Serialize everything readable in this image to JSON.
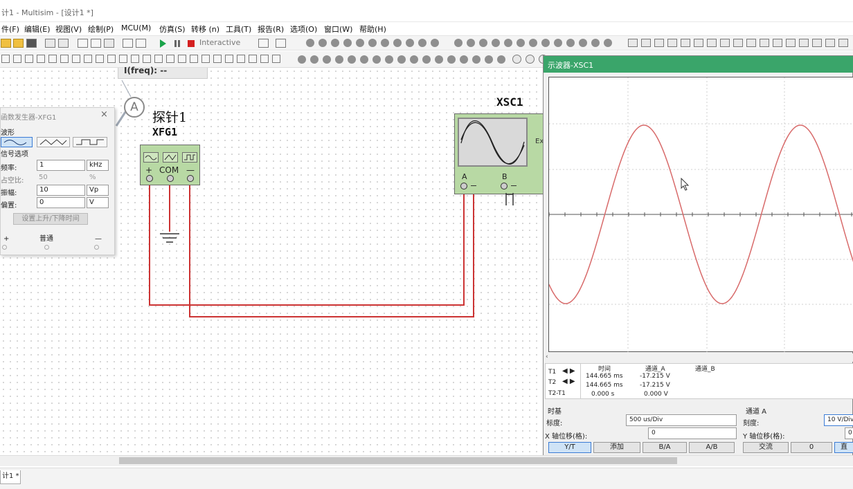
{
  "window": {
    "title": "计1 - Multisim - [设计1 *]"
  },
  "menu": [
    "件(F)",
    "编辑(E)",
    "视图(V)",
    "绘制(P)",
    "MCU(M)",
    "仿真(S)",
    "转移 (n)",
    "工具(T)",
    "报告(R)",
    "选项(O)",
    "窗口(W)",
    "帮助(H)"
  ],
  "toolbar": {
    "mode_label": "Interactive"
  },
  "probe": {
    "readout": "I(freq): --",
    "circle_letter": "A",
    "label": "探针1"
  },
  "function_generator": {
    "ref": "XFG1",
    "terminal_labels": [
      "+",
      "COM",
      "—"
    ],
    "panel": {
      "title": "函数发生器-XFG1",
      "close": "×",
      "waveform_section": "波形",
      "signal_section": "信号选项",
      "rows": [
        {
          "label": "频率:",
          "value": "1",
          "unit": "kHz"
        },
        {
          "label": "占空比:",
          "value": "50",
          "unit": "%"
        },
        {
          "label": "振幅:",
          "value": "10",
          "unit": "Vp"
        },
        {
          "label": "偏置:",
          "value": "0",
          "unit": "V"
        }
      ],
      "rise_fall_button": "设置上升/下降时间",
      "plus": "+",
      "common": "普通",
      "minus": "—"
    }
  },
  "oscilloscope": {
    "ref": "XSC1",
    "ext_label": "Ex",
    "channel_a": "A",
    "channel_b": "B",
    "window_title": "示波器-XSC1",
    "measure": {
      "headers": [
        "时间",
        "通道_A",
        "通道_B"
      ],
      "rows": [
        {
          "name": "T1",
          "time": "144.665 ms",
          "a": "-17.215 V"
        },
        {
          "name": "T2",
          "time": "144.665 ms",
          "a": "-17.215 V"
        },
        {
          "name": "T2-T1",
          "time": "0.000 s",
          "a": "0.000 V"
        }
      ]
    },
    "timebase": {
      "section": "时基",
      "scale_label": "标度:",
      "scale_value": "500 us/Div",
      "xpos_label": "X 轴位移(格):",
      "xpos_value": "0",
      "buttons": [
        "Y/T",
        "添加",
        "B/A",
        "A/B"
      ]
    },
    "channel_a_panel": {
      "section": "通道 A",
      "scale_label": "刻度:",
      "scale_value": "10  V/Div",
      "ypos_label": "Y 轴位移(格):",
      "ypos_value": "0",
      "buttons": [
        "交流",
        "0",
        "直"
      ]
    }
  },
  "tabs": {
    "sheet": "计1 *"
  },
  "colors": {
    "wire": "#cc3333",
    "trace": "#d86a6a",
    "titlebar": "#3aa56a",
    "component": "#b8d9a4"
  }
}
